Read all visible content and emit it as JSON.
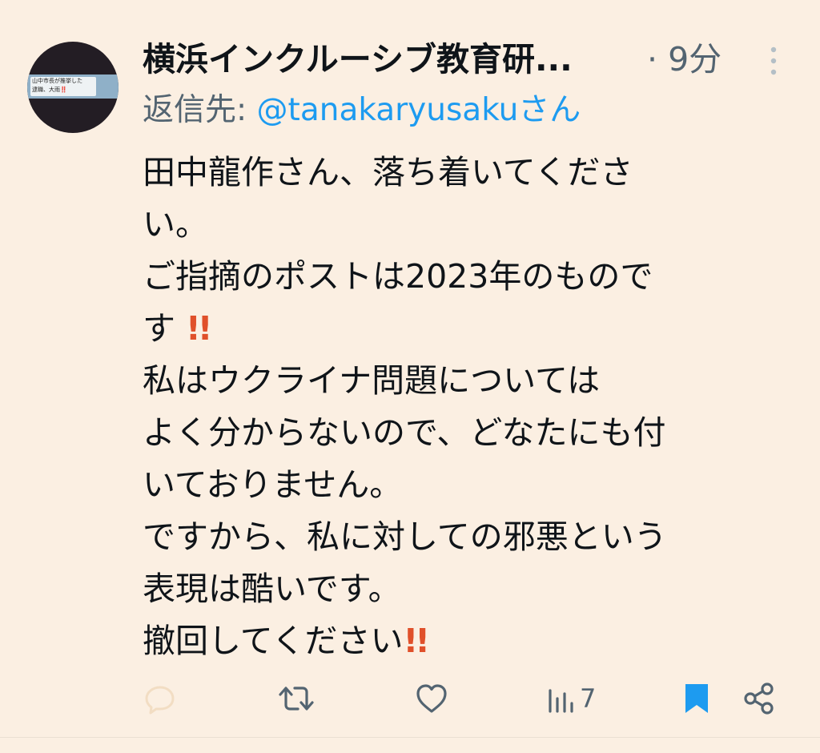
{
  "header": {
    "display_name": "横浜インクルーシブ教育研...",
    "time": "· 9分"
  },
  "avatar": {
    "banner_text_line1": "山中市長が推挙した",
    "banner_text_line2": "逮職、大雨‼️"
  },
  "reply": {
    "prefix": "返信先: ",
    "handle": "@tanakaryusakuさん"
  },
  "body": {
    "lines": [
      "田中龍作さん、落ち着いてくださ",
      "い。",
      "ご指摘のポストは2023年のもので",
      "す",
      "私はウクライナ問題については",
      "よく分からないので、どなたにも付",
      "いておりません。",
      "ですから、私に対しての邪悪という",
      "表現は酷いです。",
      "撤回してください"
    ],
    "emphasis": "!!"
  },
  "actions": {
    "views_count": "7"
  },
  "colors": {
    "background": "#fbefe2",
    "text": "#0f1419",
    "secondary": "#536471",
    "accent": "#1d9bf0",
    "emphasis": "#e0502a"
  },
  "icons": {
    "more": "more-vertical-icon",
    "reply": "reply-icon",
    "retweet": "retweet-icon",
    "like": "heart-icon",
    "views": "views-icon",
    "bookmark": "bookmark-icon",
    "share": "share-icon"
  }
}
